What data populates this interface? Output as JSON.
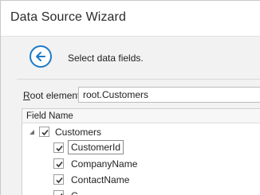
{
  "window": {
    "title": "Data Source Wizard"
  },
  "header": {
    "subtitle": "Select data fields."
  },
  "root_element": {
    "label_prefix": "R",
    "label_rest": "oot element:",
    "value": "root.Customers"
  },
  "tree": {
    "column_header": "Field Name",
    "parent": {
      "label": "Customers",
      "checked": true,
      "expanded": true
    },
    "children": [
      {
        "label": "CustomerId",
        "checked": true,
        "focused": true
      },
      {
        "label": "CompanyName",
        "checked": true
      },
      {
        "label": "ContactName",
        "checked": true
      },
      {
        "label": "C",
        "checked": true
      }
    ]
  },
  "colors": {
    "accent": "#1e7bc8",
    "background": "#f2f2f2"
  },
  "icons": {
    "back": "back-arrow-icon",
    "check": "checkmark-icon",
    "expander": "chevron-down-icon"
  }
}
